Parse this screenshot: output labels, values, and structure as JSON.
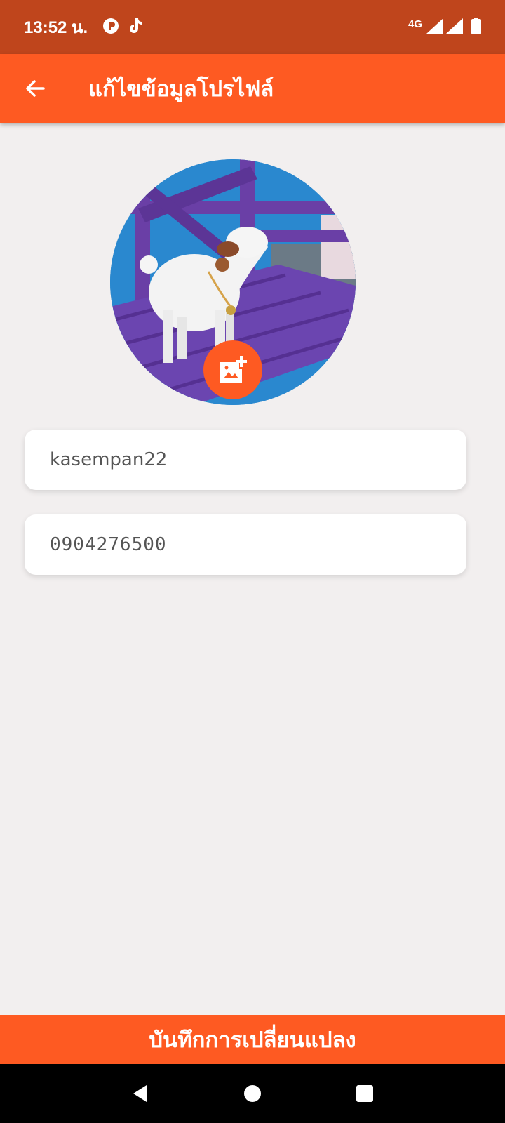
{
  "status_bar": {
    "time": "13:52 น.",
    "network": "4G"
  },
  "app_bar": {
    "title": "แก้ไขข้อมูลโปรไฟล์"
  },
  "profile": {
    "username": "kasempan22",
    "phone": "0904276500"
  },
  "actions": {
    "save_label": "บันทึกการเปลี่ยนแปลง"
  },
  "colors": {
    "status_bar": "#bf451c",
    "accent": "#fe5a22",
    "background": "#f2efef"
  }
}
